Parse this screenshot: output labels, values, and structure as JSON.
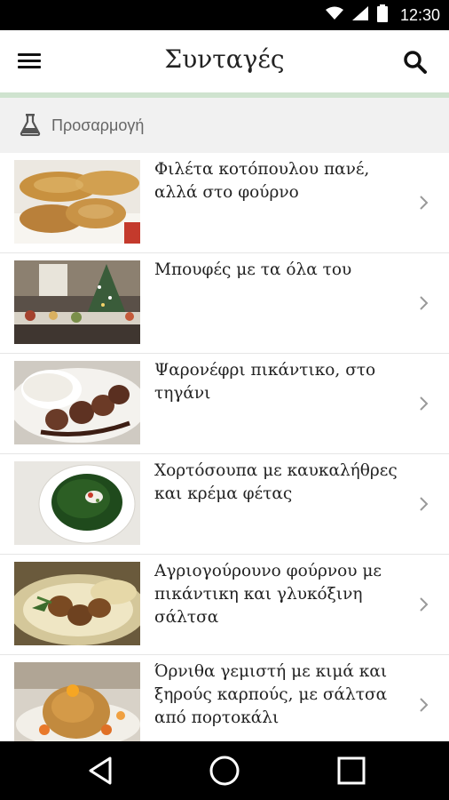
{
  "status_bar": {
    "time": "12:30",
    "icons": [
      "wifi-icon",
      "signal-icon",
      "battery-icon"
    ]
  },
  "app_bar": {
    "title": "Συνταγές",
    "menu_icon": "menu-icon",
    "search_icon": "search-icon"
  },
  "filter": {
    "label": "Προσαρμογή",
    "icon": "flask-icon"
  },
  "recipes": [
    {
      "title": "Φιλέτα κοτόπουλου πανέ, αλλά στο φούρνο"
    },
    {
      "title": "Μπουφές με τα όλα του"
    },
    {
      "title": "Ψαρονέφρι πικάντικο, στο τηγάνι"
    },
    {
      "title": "Χορτόσουπα με καυκαλήθρες και κρέμα φέτας"
    },
    {
      "title": "Αγριογούρουνο φούρνου με πικάντικη και γλυκόξινη σάλτσα"
    },
    {
      "title": "Όρνιθα γεμιστή με κιμά και ξηρούς καρπούς, με σάλτσα από πορτοκάλι"
    }
  ],
  "nav_bar": {
    "back_icon": "back-icon",
    "home_icon": "home-icon",
    "recents_icon": "recents-icon"
  },
  "colors": {
    "accent_line": "#cfe3cf",
    "filter_bg": "#f1f1f1",
    "status_bar": "#000000",
    "nav_bar": "#000000"
  }
}
